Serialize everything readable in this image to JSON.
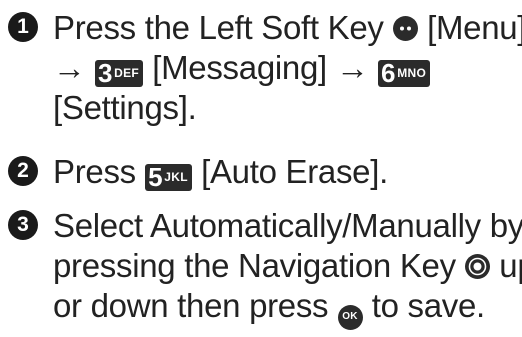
{
  "steps": [
    {
      "number": "1",
      "left_soft_key_text": "Press the Left Soft Key",
      "menu_label": "[Menu]",
      "arrow": "→",
      "key_3": {
        "digit": "3",
        "letters": "DEF"
      },
      "messaging_label": "[Messaging]",
      "key_6": {
        "digit": "6",
        "letters": "MNO"
      },
      "settings_label": "[Settings]."
    },
    {
      "number": "2",
      "press_text": "Press",
      "key_5": {
        "digit": "5",
        "letters": "JKL"
      },
      "auto_erase_label": "[Auto Erase]."
    },
    {
      "number": "3",
      "line1": "Select Automatically/Manually by",
      "line2_before": "pressing the Navigation Key",
      "line2_after": "up",
      "line3_before": "or down then press",
      "ok_label": "OK",
      "line3_after": "to save."
    }
  ],
  "icons": {
    "left_soft_key": "soft-key-dots-icon",
    "navigation_key": "navigation-key-icon",
    "ok_key": "ok-key-icon"
  }
}
